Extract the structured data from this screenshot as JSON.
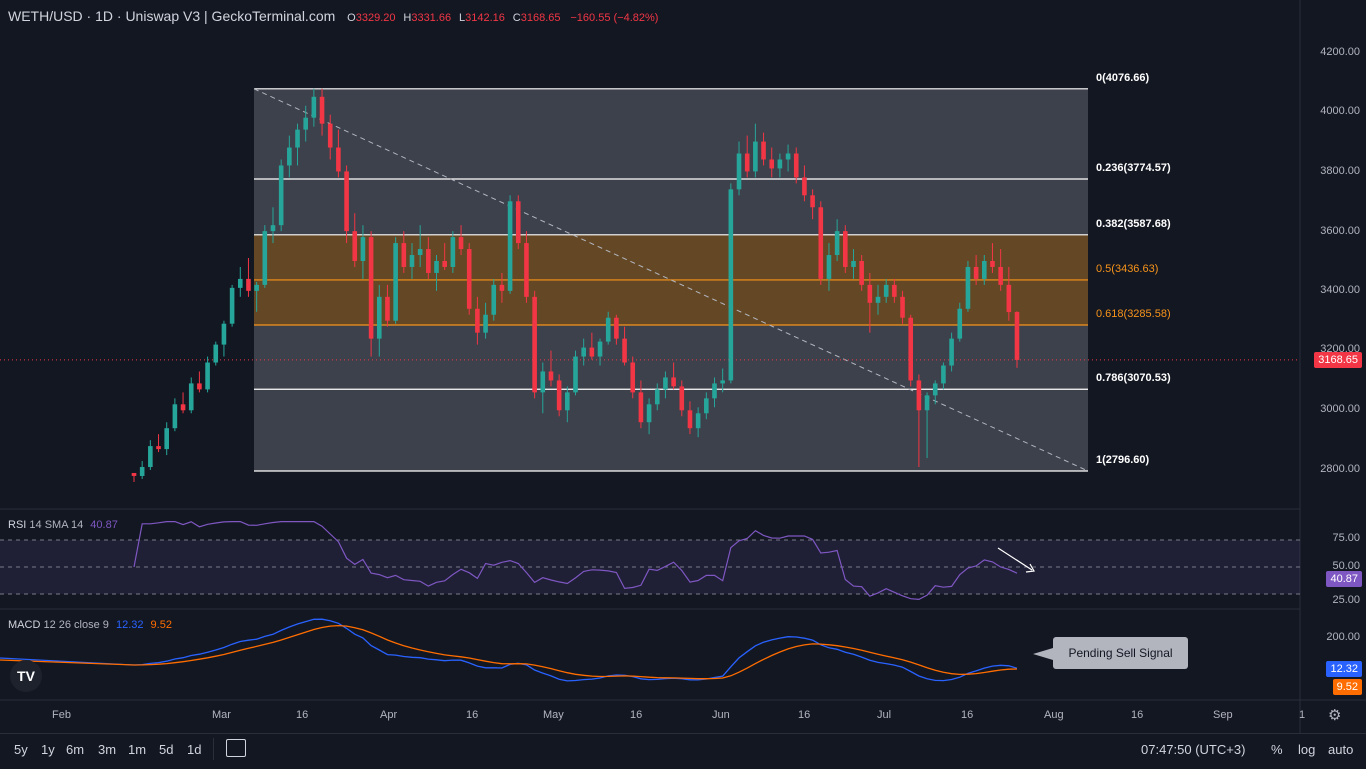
{
  "header": {
    "title": "WETH/USD · 1D · Uniswap V3 | GeckoTerminal.com",
    "o_label": "O",
    "o_value": "3329.20",
    "h_label": "H",
    "h_value": "3331.66",
    "l_label": "L",
    "l_value": "3142.16",
    "c_label": "C",
    "c_value": "3168.65",
    "change": "−160.55 (−4.82%)"
  },
  "price_axis": {
    "ticks": [
      "4200.00",
      "4000.00",
      "3800.00",
      "3600.00",
      "3400.00",
      "3200.00",
      "3000.00",
      "2800.00"
    ],
    "last_price": "3168.65"
  },
  "fibonacci": {
    "levels": [
      {
        "label": "0(4076.66)",
        "color": "#ffffff",
        "price": 4076.66
      },
      {
        "label": "0.236(3774.57)",
        "color": "#ffffff",
        "price": 3774.57
      },
      {
        "label": "0.382(3587.68)",
        "color": "#ffffff",
        "price": 3587.68
      },
      {
        "label": "0.5(3436.63)",
        "color": "#f7931a",
        "price": 3436.63
      },
      {
        "label": "0.618(3285.58)",
        "color": "#f7931a",
        "price": 3285.58
      },
      {
        "label": "0.786(3070.53)",
        "color": "#ffffff",
        "price": 3070.53
      },
      {
        "label": "1(2796.60)",
        "color": "#ffffff",
        "price": 2796.6
      }
    ]
  },
  "rsi": {
    "label": "RSI",
    "params": "14 SMA 14",
    "value": "40.87",
    "ticks": [
      "75.00",
      "50.00",
      "25.00"
    ]
  },
  "macd": {
    "label": "MACD",
    "params": "12 26 close 9",
    "macd_value": "12.32",
    "signal_value": "9.52",
    "ticks": [
      "200.00"
    ]
  },
  "annotation": {
    "text": "Pending Sell Signal"
  },
  "time_axis": [
    "Feb",
    "Mar",
    "16",
    "Apr",
    "16",
    "May",
    "16",
    "Jun",
    "16",
    "Jul",
    "16",
    "Aug",
    "16",
    "Sep",
    "1"
  ],
  "ranges": [
    "5y",
    "1y",
    "6m",
    "3m",
    "1m",
    "5d",
    "1d"
  ],
  "footer": {
    "clock": "07:47:50 (UTC+3)",
    "percent": "%",
    "log": "log",
    "auto": "auto"
  },
  "colors": {
    "up": "#26a69a",
    "down": "#f23645",
    "background": "#131722",
    "fib_band": "#f7931a",
    "rsi": "#7e57c2",
    "macd": "#2962ff",
    "signal": "#ff6d00"
  },
  "chart_data": {
    "type": "candlestick",
    "title": "WETH/USD · 1D · Uniswap V3",
    "ylim": [
      2700,
      4250
    ],
    "last_close": 3168.65,
    "candles": [
      [
        2790,
        2790,
        2760,
        2780
      ],
      [
        2780,
        2830,
        2770,
        2810
      ],
      [
        2810,
        2900,
        2800,
        2880
      ],
      [
        2880,
        2920,
        2860,
        2870
      ],
      [
        2870,
        2960,
        2850,
        2940
      ],
      [
        2940,
        3040,
        2930,
        3020
      ],
      [
        3020,
        3060,
        2990,
        3000
      ],
      [
        3000,
        3110,
        2990,
        3090
      ],
      [
        3090,
        3130,
        3060,
        3070
      ],
      [
        3070,
        3180,
        3060,
        3160
      ],
      [
        3160,
        3230,
        3150,
        3220
      ],
      [
        3220,
        3300,
        3180,
        3290
      ],
      [
        3290,
        3420,
        3280,
        3410
      ],
      [
        3410,
        3480,
        3380,
        3440
      ],
      [
        3440,
        3510,
        3380,
        3400
      ],
      [
        3400,
        3430,
        3330,
        3420
      ],
      [
        3420,
        3620,
        3410,
        3600
      ],
      [
        3600,
        3680,
        3560,
        3620
      ],
      [
        3620,
        3840,
        3600,
        3820
      ],
      [
        3820,
        3920,
        3780,
        3880
      ],
      [
        3880,
        3960,
        3820,
        3940
      ],
      [
        3940,
        4020,
        3900,
        3980
      ],
      [
        3980,
        4077,
        3950,
        4050
      ],
      [
        4050,
        4077,
        3920,
        3960
      ],
      [
        3960,
        3990,
        3840,
        3880
      ],
      [
        3880,
        3940,
        3780,
        3800
      ],
      [
        3800,
        3820,
        3560,
        3600
      ],
      [
        3600,
        3660,
        3480,
        3500
      ],
      [
        3500,
        3620,
        3440,
        3580
      ],
      [
        3580,
        3600,
        3180,
        3240
      ],
      [
        3240,
        3420,
        3180,
        3380
      ],
      [
        3380,
        3420,
        3280,
        3300
      ],
      [
        3300,
        3580,
        3290,
        3560
      ],
      [
        3560,
        3600,
        3460,
        3480
      ],
      [
        3480,
        3560,
        3440,
        3520
      ],
      [
        3520,
        3620,
        3480,
        3540
      ],
      [
        3540,
        3580,
        3440,
        3460
      ],
      [
        3460,
        3520,
        3400,
        3500
      ],
      [
        3500,
        3560,
        3470,
        3480
      ],
      [
        3480,
        3600,
        3460,
        3580
      ],
      [
        3580,
        3620,
        3520,
        3540
      ],
      [
        3540,
        3560,
        3320,
        3340
      ],
      [
        3340,
        3380,
        3220,
        3260
      ],
      [
        3260,
        3360,
        3240,
        3320
      ],
      [
        3320,
        3440,
        3300,
        3420
      ],
      [
        3420,
        3460,
        3360,
        3400
      ],
      [
        3400,
        3720,
        3390,
        3700
      ],
      [
        3700,
        3720,
        3540,
        3560
      ],
      [
        3560,
        3600,
        3360,
        3380
      ],
      [
        3380,
        3400,
        3040,
        3060
      ],
      [
        3060,
        3160,
        2990,
        3130
      ],
      [
        3130,
        3200,
        3080,
        3100
      ],
      [
        3100,
        3120,
        2980,
        3000
      ],
      [
        3000,
        3080,
        2960,
        3060
      ],
      [
        3060,
        3200,
        3050,
        3180
      ],
      [
        3180,
        3240,
        3150,
        3210
      ],
      [
        3210,
        3260,
        3170,
        3180
      ],
      [
        3180,
        3240,
        3150,
        3230
      ],
      [
        3230,
        3330,
        3220,
        3310
      ],
      [
        3310,
        3320,
        3220,
        3240
      ],
      [
        3240,
        3280,
        3150,
        3160
      ],
      [
        3160,
        3180,
        3040,
        3060
      ],
      [
        3060,
        3100,
        2940,
        2960
      ],
      [
        2960,
        3040,
        2920,
        3020
      ],
      [
        3020,
        3090,
        3000,
        3070
      ],
      [
        3070,
        3130,
        3040,
        3110
      ],
      [
        3110,
        3160,
        3070,
        3080
      ],
      [
        3080,
        3100,
        2980,
        3000
      ],
      [
        3000,
        3030,
        2920,
        2940
      ],
      [
        2940,
        3010,
        2910,
        2990
      ],
      [
        2990,
        3060,
        2970,
        3040
      ],
      [
        3040,
        3110,
        3010,
        3090
      ],
      [
        3090,
        3140,
        3060,
        3100
      ],
      [
        3100,
        3760,
        3090,
        3740
      ],
      [
        3740,
        3900,
        3720,
        3860
      ],
      [
        3860,
        3920,
        3780,
        3800
      ],
      [
        3800,
        3960,
        3780,
        3900
      ],
      [
        3900,
        3930,
        3820,
        3840
      ],
      [
        3840,
        3880,
        3780,
        3810
      ],
      [
        3810,
        3860,
        3780,
        3840
      ],
      [
        3840,
        3890,
        3800,
        3860
      ],
      [
        3860,
        3880,
        3760,
        3780
      ],
      [
        3780,
        3820,
        3700,
        3720
      ],
      [
        3720,
        3740,
        3640,
        3680
      ],
      [
        3680,
        3700,
        3420,
        3440
      ],
      [
        3440,
        3560,
        3400,
        3520
      ],
      [
        3520,
        3640,
        3500,
        3600
      ],
      [
        3600,
        3620,
        3460,
        3480
      ],
      [
        3480,
        3540,
        3440,
        3500
      ],
      [
        3500,
        3520,
        3400,
        3420
      ],
      [
        3420,
        3460,
        3260,
        3360
      ],
      [
        3360,
        3420,
        3320,
        3380
      ],
      [
        3380,
        3440,
        3360,
        3420
      ],
      [
        3420,
        3440,
        3360,
        3380
      ],
      [
        3380,
        3400,
        3290,
        3310
      ],
      [
        3310,
        3320,
        3080,
        3100
      ],
      [
        3100,
        3120,
        2810,
        3000
      ],
      [
        3000,
        3060,
        2840,
        3050
      ],
      [
        3050,
        3100,
        3020,
        3090
      ],
      [
        3090,
        3160,
        3070,
        3150
      ],
      [
        3150,
        3260,
        3130,
        3240
      ],
      [
        3240,
        3360,
        3230,
        3340
      ],
      [
        3340,
        3500,
        3330,
        3480
      ],
      [
        3480,
        3520,
        3420,
        3440
      ],
      [
        3440,
        3520,
        3420,
        3500
      ],
      [
        3500,
        3560,
        3460,
        3480
      ],
      [
        3480,
        3540,
        3400,
        3420
      ],
      [
        3420,
        3480,
        3300,
        3329
      ],
      [
        3329.2,
        3331.66,
        3142.16,
        3168.65
      ]
    ]
  }
}
